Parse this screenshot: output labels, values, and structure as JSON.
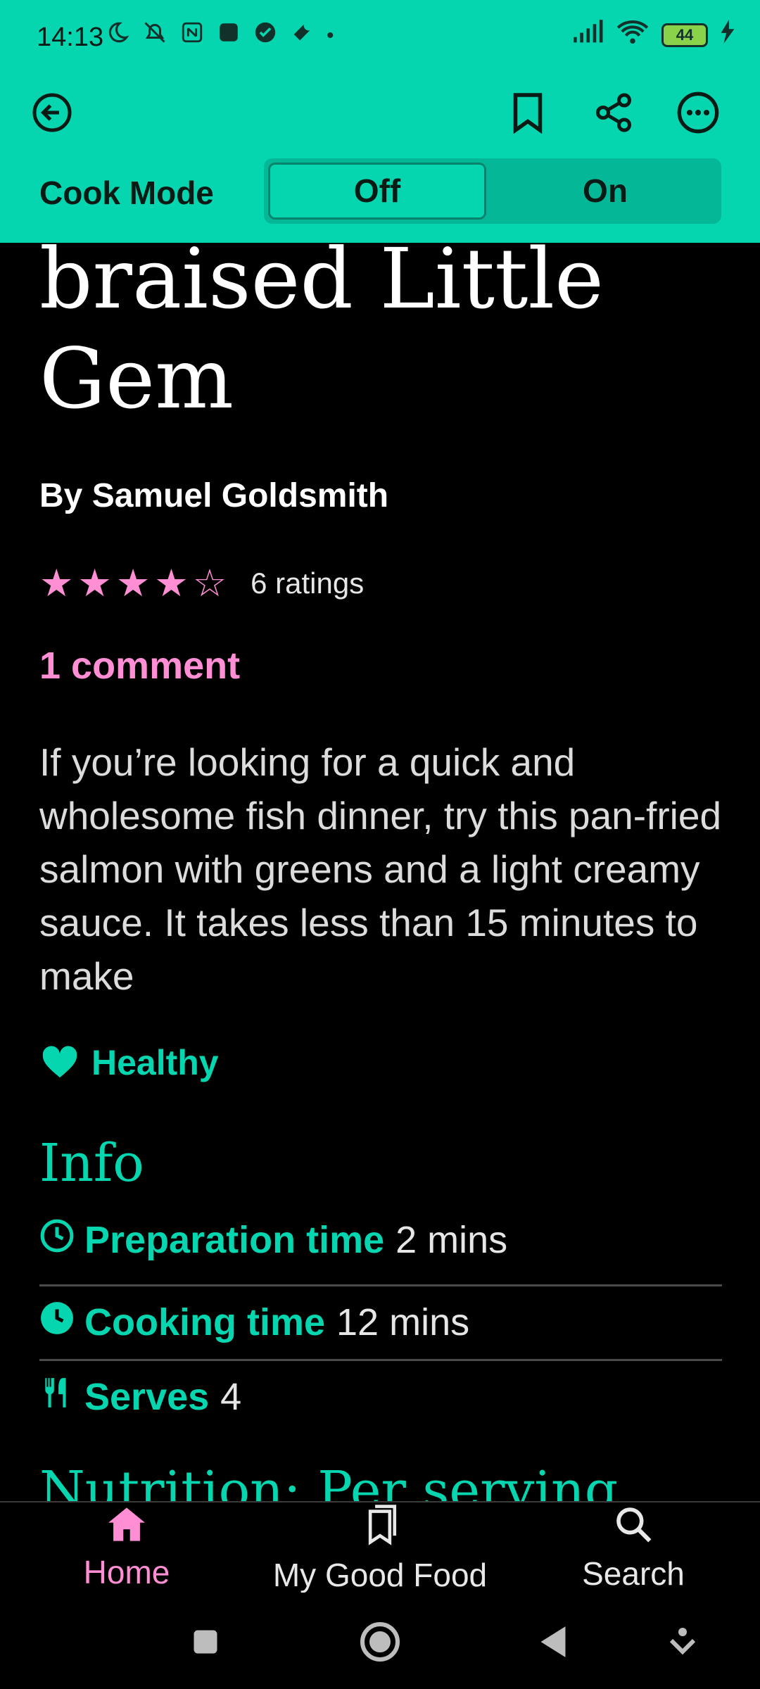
{
  "status_bar": {
    "time": "14:13",
    "battery": "44"
  },
  "header": {
    "cook_mode_label": "Cook Mode",
    "toggle_off": "Off",
    "toggle_on": "On",
    "icons": [
      "back-icon",
      "bookmark-icon",
      "share-icon",
      "more-icon"
    ]
  },
  "recipe": {
    "title": "braised Little Gem",
    "author": "By Samuel Goldsmith",
    "rating_stars": 4,
    "rating_out_of": 5,
    "ratings_count": "6 ratings",
    "comments": "1 comment",
    "description": "If you’re looking for a quick and wholesome fish dinner, try this pan-fried salmon with greens and a light creamy sauce. It takes less than 15 minutes to make",
    "tag": "Healthy"
  },
  "info": {
    "heading": "Info",
    "rows": [
      {
        "label": "Preparation time",
        "value": "2 mins",
        "icon": "clock-outline-icon"
      },
      {
        "label": "Cooking time",
        "value": "12 mins",
        "icon": "clock-filled-icon"
      },
      {
        "label": "Serves",
        "value": "4",
        "icon": "cutlery-icon"
      }
    ]
  },
  "nutrition": {
    "heading": "Nutrition: Per serving"
  },
  "bottom_nav": {
    "tabs": [
      {
        "label": "Home",
        "icon": "home-icon",
        "active": true
      },
      {
        "label": "My Good Food",
        "icon": "saved-icon",
        "active": false
      },
      {
        "label": "Search",
        "icon": "search-icon",
        "active": false
      }
    ]
  },
  "colors": {
    "accent": "#05d6b0",
    "pink": "#ff8ed4",
    "background": "#000000"
  }
}
